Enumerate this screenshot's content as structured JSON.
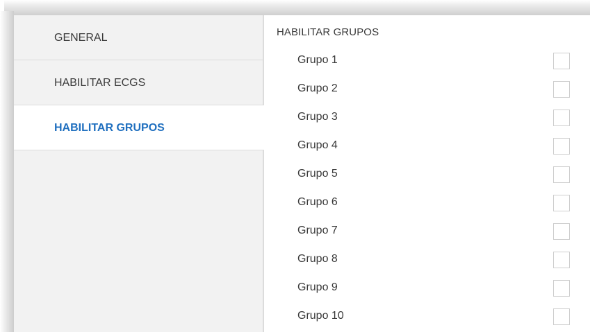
{
  "sidebar": {
    "items": [
      {
        "label": "GENERAL",
        "active": false
      },
      {
        "label": "HABILITAR ECGS",
        "active": false
      },
      {
        "label": "HABILITAR GRUPOS",
        "active": true
      }
    ]
  },
  "main": {
    "section_title": "HABILITAR GRUPOS",
    "groups": [
      {
        "label": "Grupo 1",
        "checked": false
      },
      {
        "label": "Grupo 2",
        "checked": false
      },
      {
        "label": "Grupo 3",
        "checked": false
      },
      {
        "label": "Grupo 4",
        "checked": false
      },
      {
        "label": "Grupo 5",
        "checked": false
      },
      {
        "label": "Grupo 6",
        "checked": false
      },
      {
        "label": "Grupo 7",
        "checked": false
      },
      {
        "label": "Grupo 8",
        "checked": false
      },
      {
        "label": "Grupo 9",
        "checked": false
      },
      {
        "label": "Grupo 10",
        "checked": false
      }
    ]
  },
  "colors": {
    "accent": "#1f6fbf",
    "text": "#3a3a3a",
    "sidebar_bg": "#f2f2f2",
    "border": "#dcdcdc"
  }
}
